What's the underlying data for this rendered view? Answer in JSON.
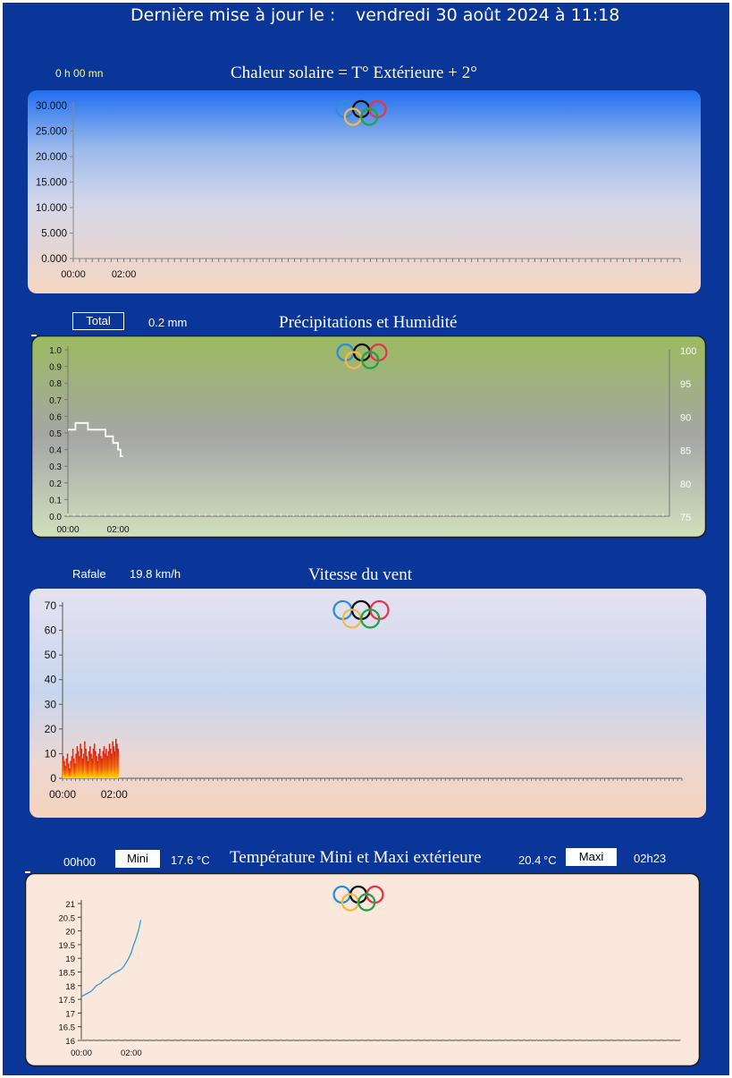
{
  "header": {
    "prefix": "Dernière mise à jour le :",
    "datetime": "vendredi 30 août 2024 à 11:18"
  },
  "solar": {
    "duration": "0 h 00 mn",
    "title": "Chaleur solaire = T° Extérieure + 2°"
  },
  "rain": {
    "total_label": "Total",
    "total_value": "0.2 mm",
    "title": "Précipitations et Humidité"
  },
  "wind": {
    "gust_label": "Rafale",
    "gust_value": "19.8 km/h",
    "title": "Vitesse du vent"
  },
  "temp": {
    "min_time": "00h00",
    "min_label": "Mini",
    "min_value": "17.6",
    "min_unit": "°C",
    "title": "Température Mini et Maxi extérieure",
    "max_value": "20.4",
    "max_unit": "°C",
    "max_label": "Maxi",
    "max_time": "02h23"
  },
  "colors": {
    "background": "#0b3699",
    "wind_bars": "#e02010",
    "wind_fill": "#ffd000",
    "temp_line": "#2a9fd6",
    "humidity_line": "#ffffff",
    "ring_blue": "#2a8fd6",
    "ring_black": "#111111",
    "ring_red": "#e8344a",
    "ring_yellow": "#f4b942",
    "ring_green": "#1fa34a"
  },
  "chart_data": [
    {
      "id": "solar",
      "type": "line",
      "title": "Chaleur solaire = T° Extérieure + 2°",
      "ylim": [
        0,
        30
      ],
      "ytick_labels": [
        "30.000",
        "25.000",
        "20.000",
        "15.000",
        "10.000",
        "5.000",
        "0.000"
      ],
      "yticks": [
        30,
        25,
        20,
        15,
        10,
        5,
        0
      ],
      "xtick_labels": [
        "00:00",
        "02:00"
      ],
      "x_span_hours": 24,
      "series": []
    },
    {
      "id": "rain",
      "type": "line",
      "title": "Précipitations et Humidité",
      "ylim": [
        0,
        1
      ],
      "ytick_labels": [
        "1.0",
        "0.9",
        "0.8",
        "0.7",
        "0.6",
        "0.5",
        "0.4",
        "0.3",
        "0.2",
        "0.1",
        "0.0"
      ],
      "yticks": [
        1,
        0.9,
        0.8,
        0.7,
        0.6,
        0.5,
        0.4,
        0.3,
        0.2,
        0.1,
        0
      ],
      "y2lim": [
        75,
        100
      ],
      "y2tick_labels": [
        "100",
        "95",
        "90",
        "85",
        "80",
        "75"
      ],
      "y2ticks": [
        100,
        95,
        90,
        85,
        80,
        75
      ],
      "xtick_labels": [
        "00:00",
        "02:00"
      ],
      "x_span_hours": 24,
      "series": [
        {
          "axis": "y2",
          "x_hours": [
            0,
            0.3,
            0.3,
            0.8,
            0.8,
            1.5,
            1.5,
            1.8,
            1.8,
            2.0,
            2.0,
            2.1,
            2.1,
            2.2
          ],
          "values": [
            88,
            88,
            89,
            89,
            88,
            88,
            87,
            87,
            86,
            86,
            85,
            85,
            84,
            84
          ]
        }
      ]
    },
    {
      "id": "wind",
      "type": "bar",
      "title": "Vitesse du vent",
      "ylim": [
        0,
        70
      ],
      "ytick_labels": [
        "70",
        "60",
        "50",
        "40",
        "30",
        "20",
        "10",
        "0"
      ],
      "yticks": [
        70,
        60,
        50,
        40,
        30,
        20,
        10,
        0
      ],
      "xtick_labels": [
        "00:00",
        "02:00"
      ],
      "x_span_hours": 24,
      "bar_step_hours": 0.0417,
      "values": [
        9,
        7,
        5,
        8,
        10,
        6,
        4,
        7,
        9,
        12,
        8,
        6,
        10,
        13,
        11,
        9,
        14,
        12,
        8,
        10,
        15,
        12,
        9,
        7,
        11,
        13,
        10,
        8,
        12,
        14,
        11,
        9,
        7,
        10,
        12,
        9,
        8,
        11,
        13,
        10,
        12,
        9,
        11,
        14,
        12,
        10,
        15,
        13,
        11,
        16,
        14,
        12
      ]
    },
    {
      "id": "temp",
      "type": "line",
      "title": "Température Mini et Maxi extérieure",
      "ylim": [
        16,
        21
      ],
      "ytick_labels": [
        "21",
        "20.5",
        "20",
        "19.5",
        "19",
        "18.5",
        "18",
        "17.5",
        "17",
        "16.5",
        "16"
      ],
      "yticks": [
        21,
        20.5,
        20,
        19.5,
        19,
        18.5,
        18,
        17.5,
        17,
        16.5,
        16
      ],
      "xtick_labels": [
        "00:00",
        "02:00"
      ],
      "x_span_hours": 24,
      "series": [
        {
          "x_hours": [
            0,
            0.1,
            0.2,
            0.3,
            0.4,
            0.5,
            0.6,
            0.7,
            0.8,
            0.9,
            1.0,
            1.1,
            1.2,
            1.3,
            1.4,
            1.5,
            1.6,
            1.7,
            1.8,
            1.9,
            2.0,
            2.05,
            2.1,
            2.15,
            2.2,
            2.25,
            2.3,
            2.35,
            2.38
          ],
          "values": [
            17.6,
            17.65,
            17.7,
            17.75,
            17.8,
            17.9,
            18.0,
            18.05,
            18.1,
            18.2,
            18.25,
            18.3,
            18.4,
            18.45,
            18.5,
            18.55,
            18.6,
            18.7,
            18.85,
            19.0,
            19.2,
            19.35,
            19.5,
            19.6,
            19.75,
            19.9,
            20.05,
            20.25,
            20.4
          ]
        }
      ]
    }
  ]
}
